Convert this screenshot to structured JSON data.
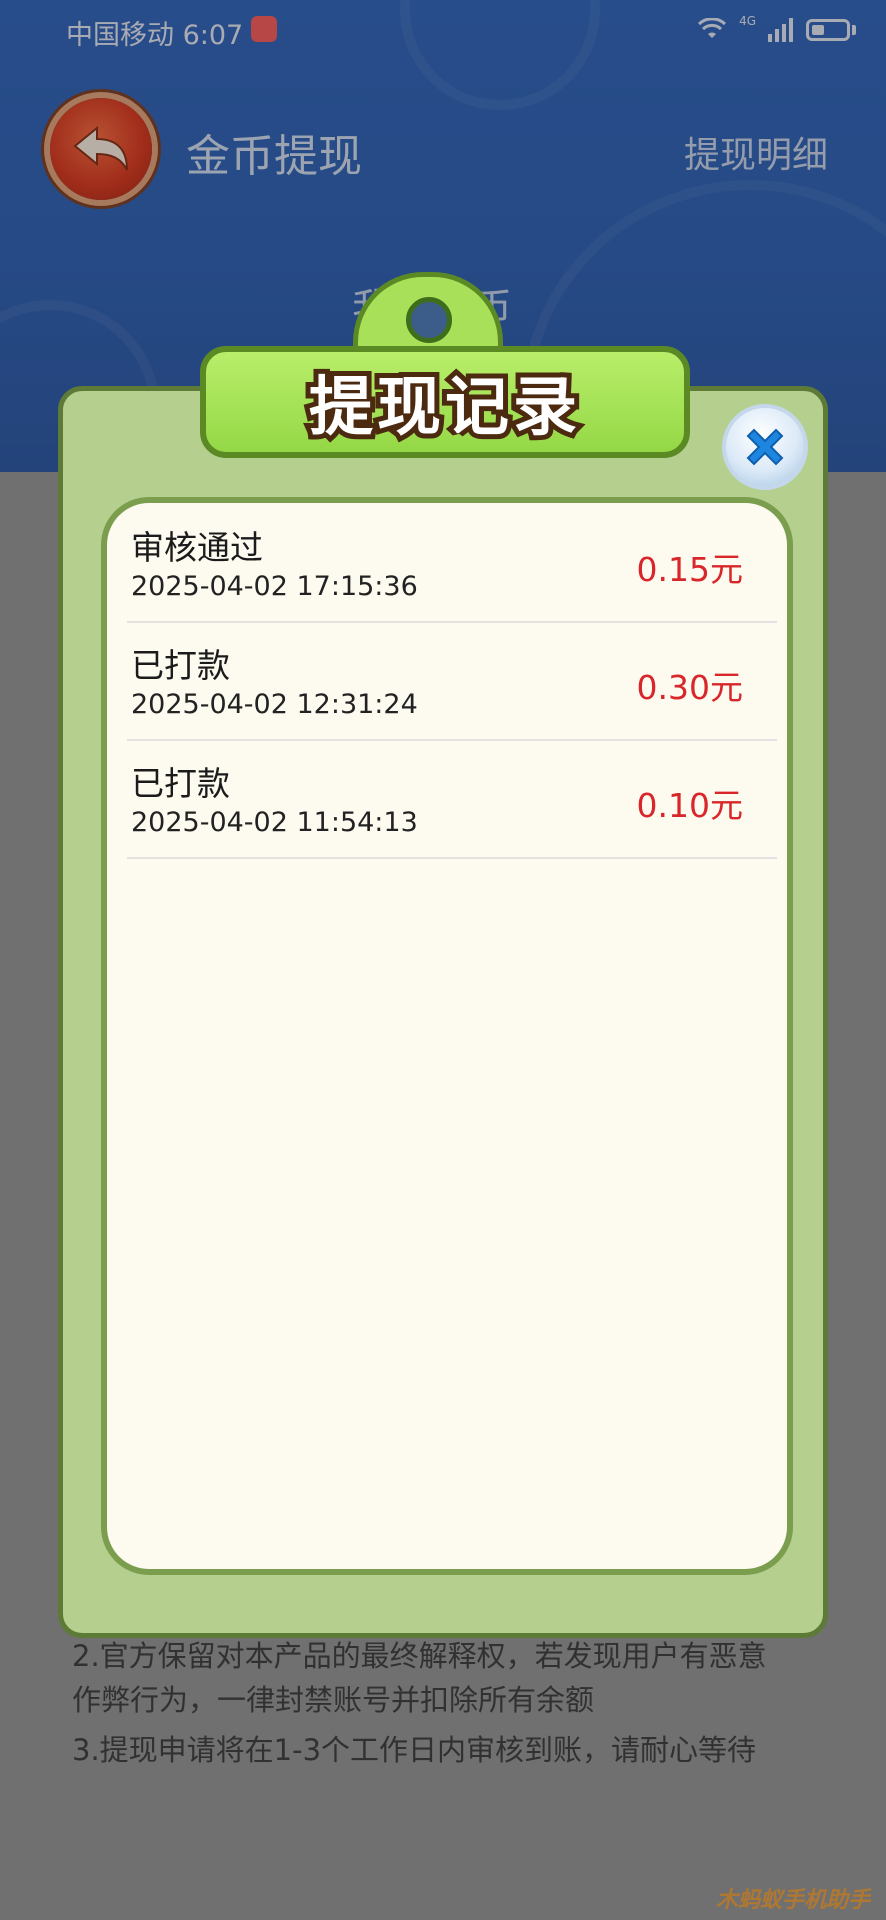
{
  "status_bar": {
    "carrier_time": "中国移动 6:07",
    "network": "4G"
  },
  "header": {
    "title": "金币提现",
    "detail_link": "提现明细",
    "coin_label": "我的金币"
  },
  "modal": {
    "title": "提现记录",
    "records": [
      {
        "status": "审核通过",
        "time": "2025-04-02 17:15:36",
        "amount": "0.15元"
      },
      {
        "status": "已打款",
        "time": "2025-04-02 12:31:24",
        "amount": "0.30元"
      },
      {
        "status": "已打款",
        "time": "2025-04-02 11:54:13",
        "amount": "0.10元"
      }
    ]
  },
  "rules": {
    "rule2": "2.官方保留对本产品的最终解释权，若发现用户有恶意作弊行为，一律封禁账号并扣除所有余额",
    "rule3": "3.提现申请将在1-3个工作日内审核到账，请耐心等待"
  },
  "watermark": "木蚂蚁手机助手",
  "colors": {
    "header_blue": "#2b63bd",
    "amount_red": "#d8262a",
    "modal_green": "#b4cf8e",
    "title_tab_green": "#a8e05a"
  }
}
